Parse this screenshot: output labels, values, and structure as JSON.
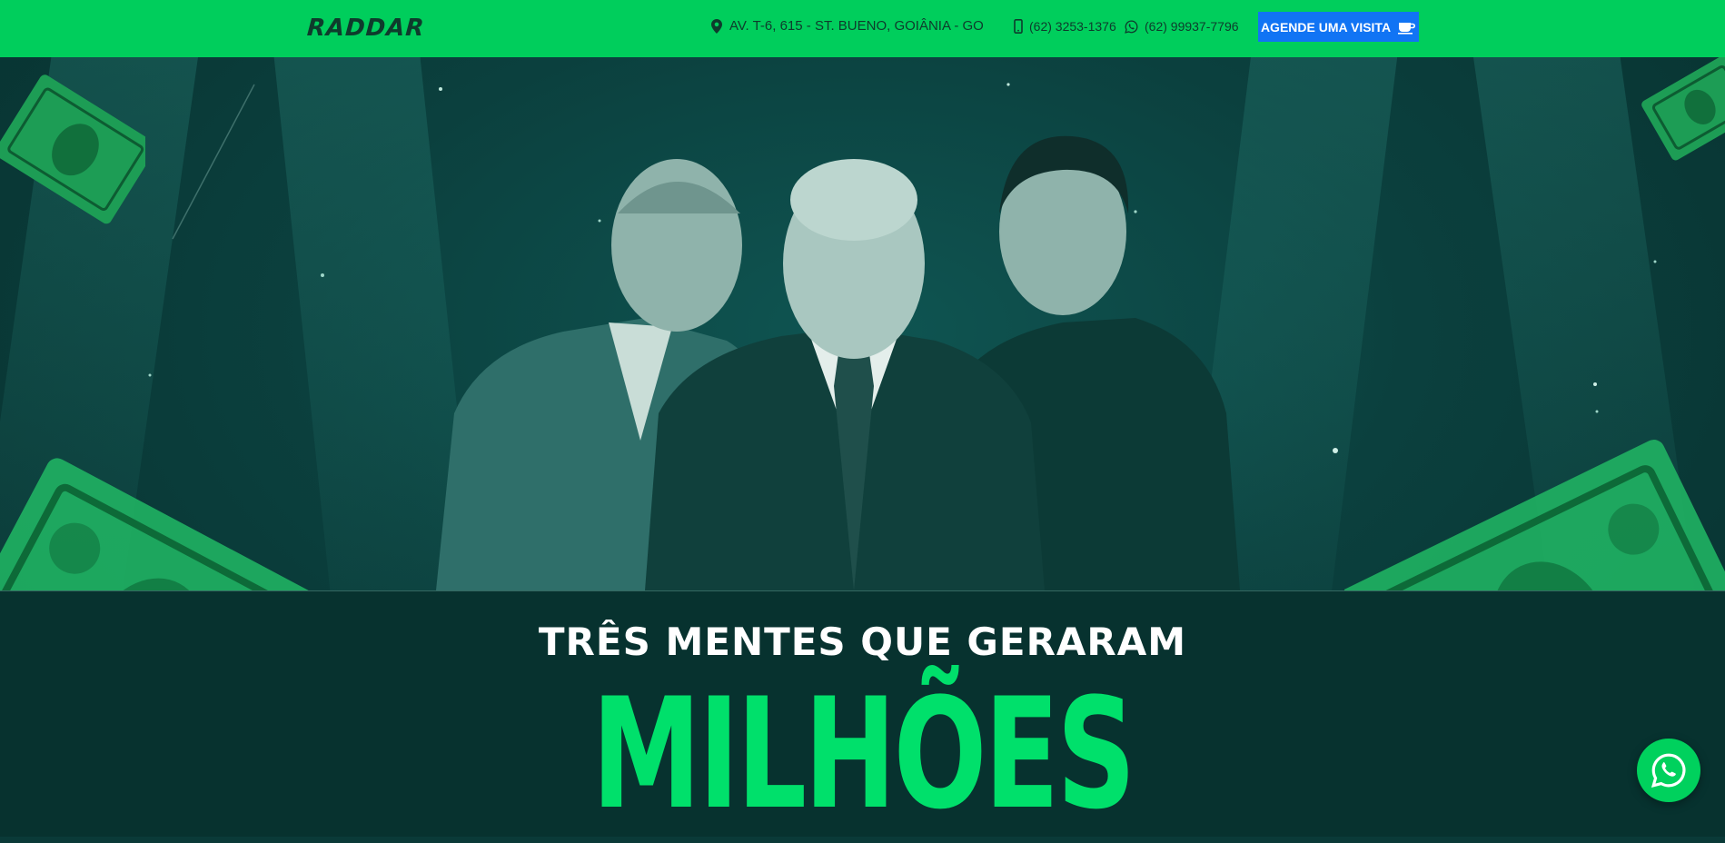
{
  "header": {
    "logo_text": "RADDAR",
    "address": "AV. T-6, 615 - ST. BUENO, GOIÂNIA - GO",
    "phone_landline": "(62) 3253-1376",
    "phone_whatsapp": "(62) 99937-7796",
    "cta_label": "AGENDE UMA VISITA"
  },
  "hero": {
    "headline": "TRÊS MENTES QUE GERARAM",
    "highlight": "MILHÕES"
  },
  "icons": {
    "address": "map-pin-icon",
    "landline": "mobile-phone-icon",
    "whatsapp": "whatsapp-icon",
    "cta": "coffee-cup-icon",
    "floating": "whatsapp-icon"
  },
  "colors": {
    "topbar": "#00ce5c",
    "cta": "#1174f4",
    "hero_bg": "#0a3a38",
    "highlight": "#00e06b"
  }
}
